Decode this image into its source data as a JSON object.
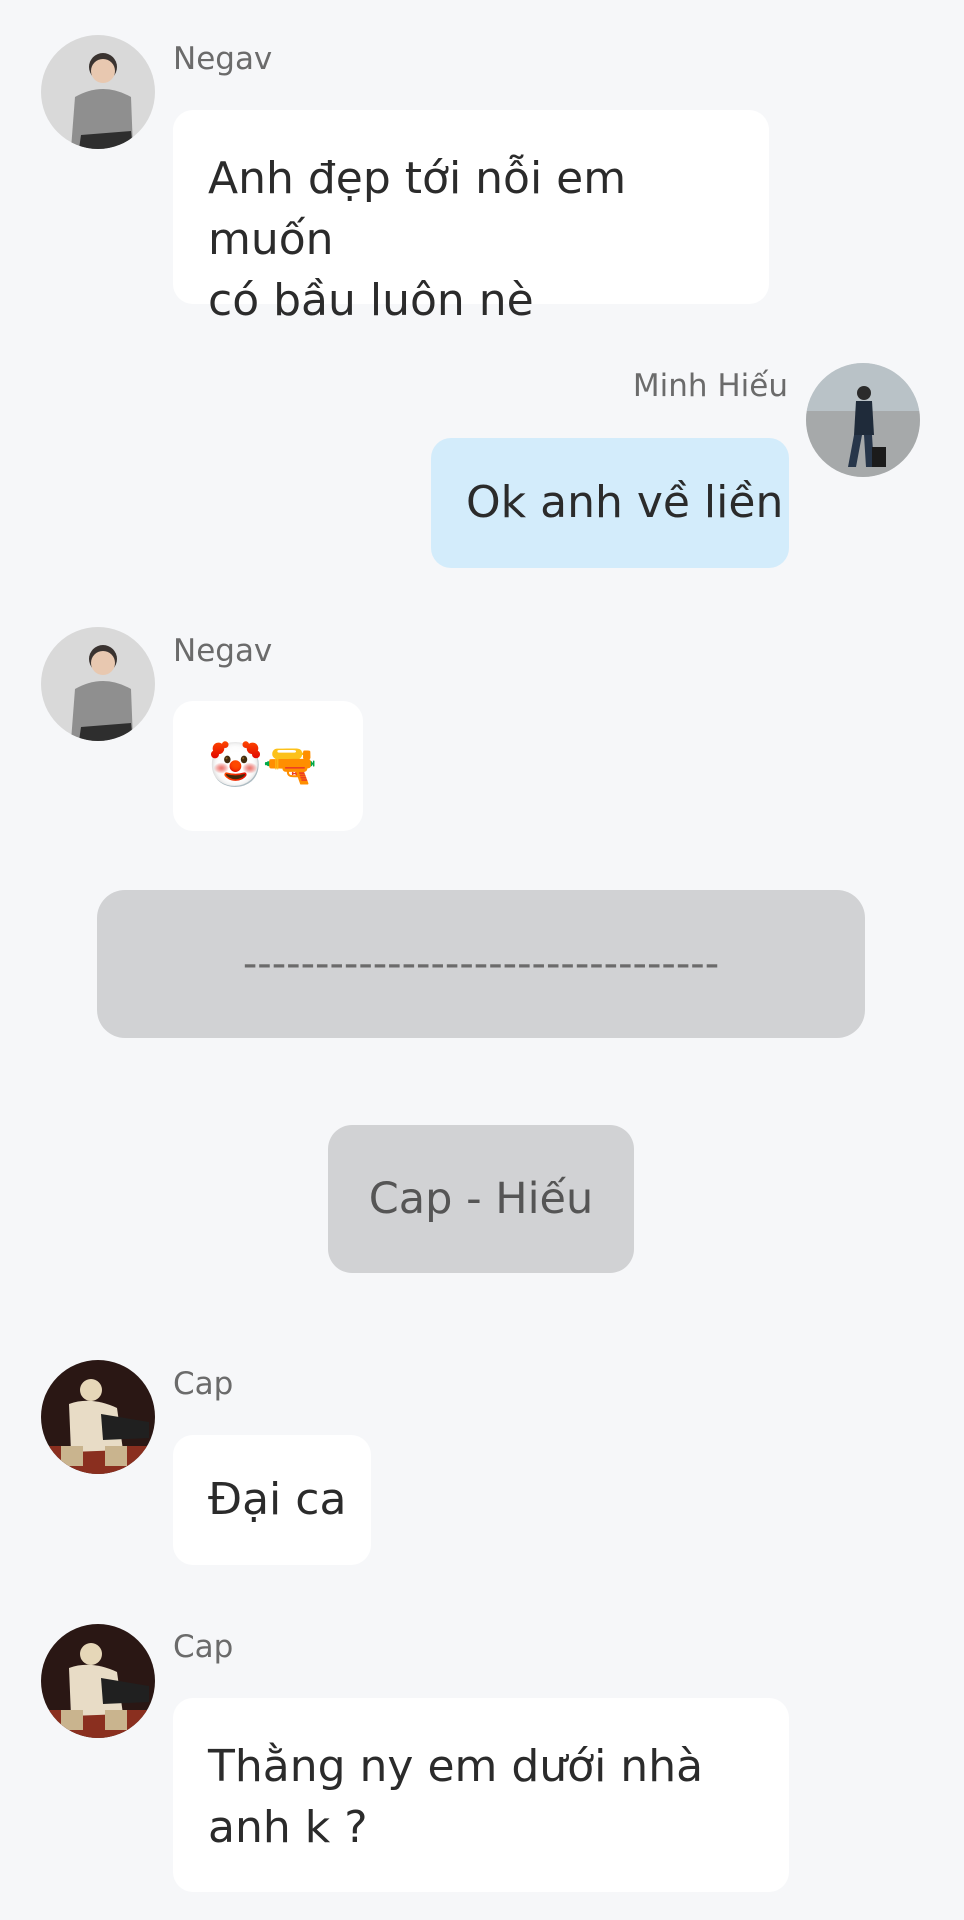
{
  "messages": [
    {
      "sender": "Negav",
      "avatar": "avatar-negav-photo",
      "direction": "incoming",
      "lines": [
        "Anh đẹp tới nỗi em muốn",
        "có bầu luôn nè"
      ]
    },
    {
      "sender": "Minh Hiếu",
      "avatar": "avatar-minh-hieu-photo",
      "direction": "outgoing",
      "lines": [
        "Ok anh về liền"
      ]
    },
    {
      "sender": "Negav",
      "avatar": "avatar-negav-photo",
      "direction": "incoming",
      "lines": [
        "🤡🔫"
      ]
    },
    {
      "sender": "Cap",
      "avatar": "avatar-cap-photo",
      "direction": "incoming",
      "lines": [
        "Đại ca"
      ]
    },
    {
      "sender": "Cap",
      "avatar": "avatar-cap-photo",
      "direction": "incoming",
      "lines": [
        "Thằng ny em dưới nhà",
        "anh k ?"
      ]
    }
  ],
  "separator": {
    "text": "---------------------------------"
  },
  "system_pill": {
    "text": "Cap - Hiếu"
  },
  "colors": {
    "background": "#f6f7f9",
    "incoming_bubble": "#ffffff",
    "outgoing_bubble": "#d3ecfb",
    "system_pill": "#d1d2d4",
    "name_text": "#6b6b6b",
    "message_text": "#2b2b2b"
  }
}
